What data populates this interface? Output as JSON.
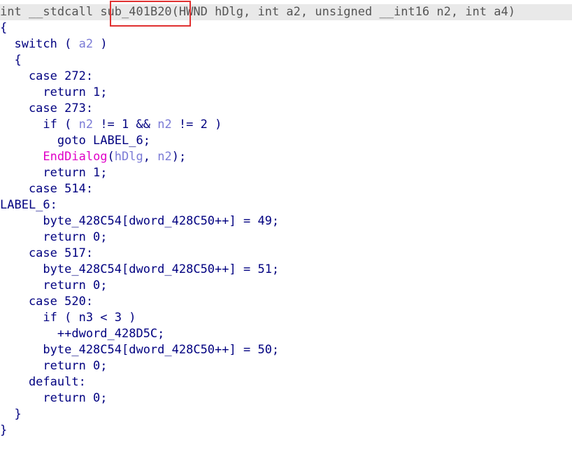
{
  "header": {
    "ret_type": "int ",
    "call_conv": "__stdcall ",
    "func_name": "sub_401B20",
    "params": "(HWND hDlg, int a2, unsigned __int16 n2, int a4)"
  },
  "code": {
    "l1": "{",
    "l2_kw": "  switch ( ",
    "l2_var": "a2",
    "l2_end": " )",
    "l3": "  {",
    "l4": "    case 272:",
    "l5": "      return 1;",
    "l6": "    case 273:",
    "l7_a": "      if ( ",
    "l7_v1": "n2",
    "l7_b": " != 1 && ",
    "l7_v2": "n2",
    "l7_c": " != 2 )",
    "l8": "        goto LABEL_6;",
    "l9_indent": "      ",
    "l9_func": "EndDialog",
    "l9_a": "(",
    "l9_v1": "hDlg",
    "l9_b": ", ",
    "l9_v2": "n2",
    "l9_c": ");",
    "l10": "      return 1;",
    "l11": "    case 514:",
    "l12": "LABEL_6:",
    "l13": "      byte_428C54[dword_428C50++] = 49;",
    "l14": "      return 0;",
    "l15": "    case 517:",
    "l16": "      byte_428C54[dword_428C50++] = 51;",
    "l17": "      return 0;",
    "l18": "    case 520:",
    "l19": "      if ( n3 < 3 )",
    "l20": "        ++dword_428D5C;",
    "l21": "      byte_428C54[dword_428C50++] = 50;",
    "l22": "      return 0;",
    "l23": "    default:",
    "l24": "      return 0;",
    "l25": "  }",
    "l26": "}"
  },
  "colors": {
    "keyword": "#000080",
    "variable": "#7b7bd6",
    "function_call": "#e000c8",
    "highlight_border": "#e03030",
    "header_bg": "#e9e9e9"
  }
}
